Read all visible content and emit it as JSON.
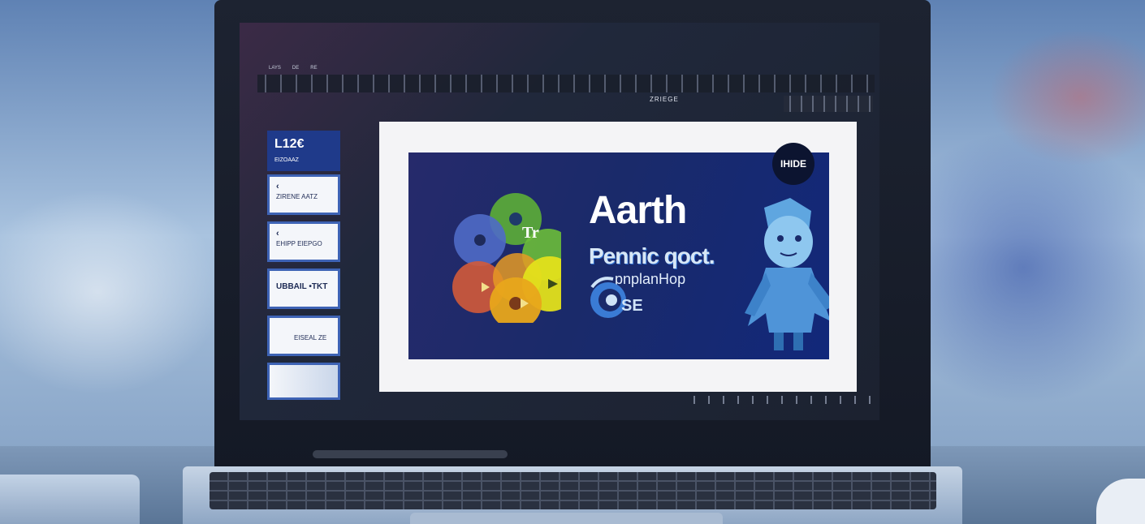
{
  "app": {
    "window_title": "",
    "doc_name": "ZRIEGE",
    "menu": [
      "LAYS",
      "DE",
      "RE"
    ]
  },
  "thumbnails": [
    {
      "big": "L12€",
      "sub": "EIZOAAZ"
    },
    {
      "chev": "‹",
      "label": "ZIRENE AATZ"
    },
    {
      "chev": "‹",
      "label": "EHIPP EIEPGO"
    },
    {
      "label": "UBBAIL •TKT"
    },
    {
      "label": "EISEAL ZE"
    },
    {
      "label": ""
    }
  ],
  "slide": {
    "title": "Aarth",
    "subtitle": "Pennic qoct.",
    "subtitle2": "pnplanHop",
    "logo_text": "SE",
    "flower_label": "Tr",
    "badge_text": "IHIDE"
  },
  "colors": {
    "slide_bg": "#1a2a6a",
    "accent": "#3e63b5",
    "petal_green": "#5aa83a",
    "petal_blue": "#4f6ac6",
    "petal_red": "#d15a3a",
    "petal_yellow": "#e3c21b",
    "petal_orange": "#e59a25"
  },
  "icons": {
    "play": "play-icon",
    "logo": "swirl-logo-icon",
    "mascot": "mascot-character-icon"
  }
}
